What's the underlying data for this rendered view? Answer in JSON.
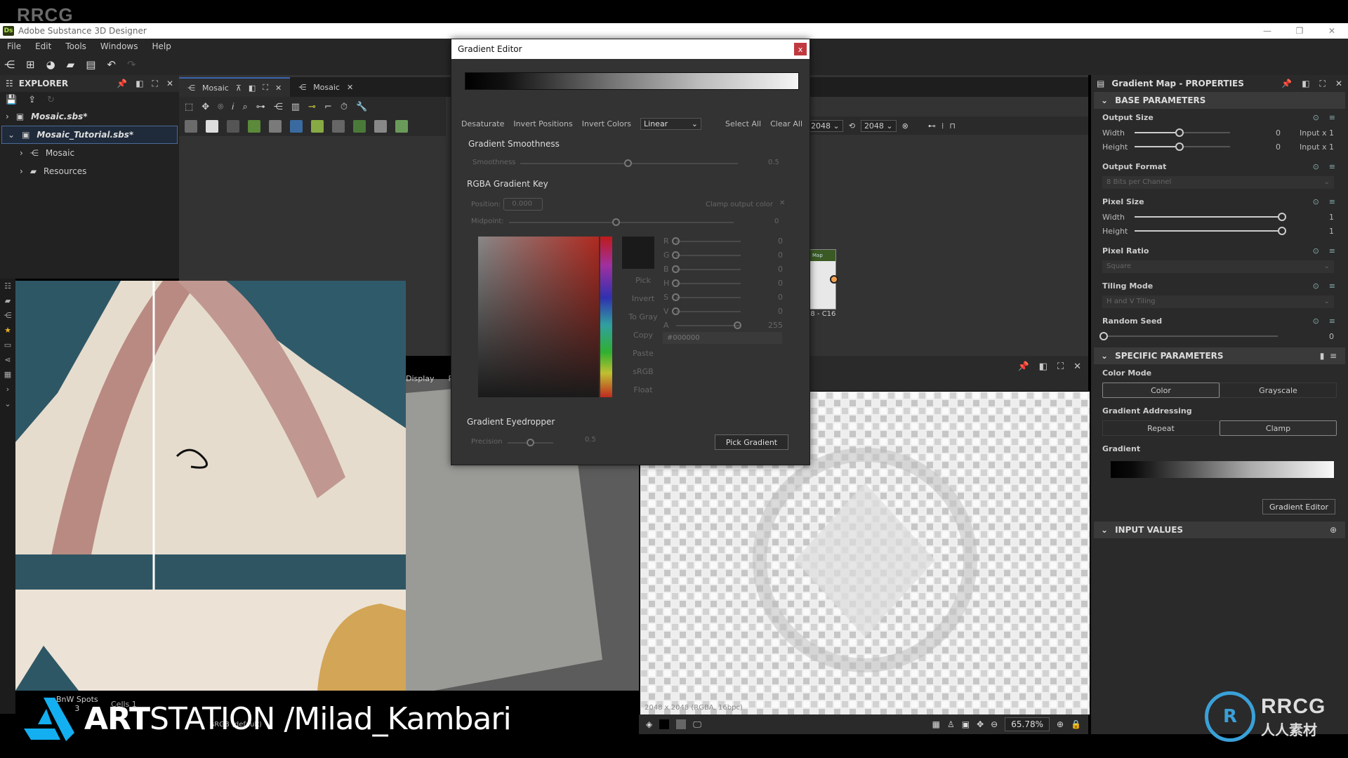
{
  "watermark_top": "RRCG",
  "app": {
    "logo": "Ds",
    "title": "Adobe Substance 3D Designer",
    "window_controls": [
      "minimize-icon",
      "restore-icon",
      "close-icon"
    ]
  },
  "menu": [
    "File",
    "Edit",
    "Tools",
    "Windows",
    "Help"
  ],
  "main_toolbar": [
    "new-graph-icon",
    "new-function-icon",
    "new-package-icon",
    "open-icon",
    "save-all-icon",
    "undo-icon",
    "redo-icon"
  ],
  "explorer": {
    "title": "EXPLORER",
    "tree": [
      {
        "label": "Mosaic.sbs*",
        "expanded": false,
        "selected": false
      },
      {
        "label": "Mosaic_Tutorial.sbs*",
        "expanded": true,
        "selected": true
      },
      {
        "label": "Mosaic",
        "type": "graph"
      },
      {
        "label": "Resources",
        "type": "folder"
      }
    ]
  },
  "graph_tabs": [
    {
      "label": "Mosaic",
      "active": true
    },
    {
      "label": "Mosaic",
      "active": false
    }
  ],
  "graph_toolbar": {
    "width_res": "2048",
    "height_res": "2048"
  },
  "node": {
    "header": "Map",
    "label": "48 - C16"
  },
  "view3d": {
    "tabs": [
      "Display",
      "R"
    ]
  },
  "view2d": {
    "info": "2048 x 2048 (RGBA, 16bpc)",
    "zoom": "65.78%"
  },
  "library_items": [
    {
      "label": "BnW Spots",
      "sub": "3"
    },
    {
      "label": "Cells 1",
      "sub": ""
    }
  ],
  "colorspace": "sRGB (default)",
  "gradient_editor": {
    "title": "Gradient Editor",
    "close": "x",
    "actions": [
      "Desaturate",
      "Invert Positions",
      "Invert Colors"
    ],
    "interpolation": "Linear",
    "select_all": "Select All",
    "clear_all": "Clear All",
    "smoothness_section": "Gradient Smoothness",
    "smoothness_label": "Smoothness",
    "smoothness_value": "0.5",
    "key_section": "RGBA Gradient Key",
    "position_label": "Position:",
    "position_value": "0.000",
    "clamp_label": "Clamp output color",
    "midpoint_label": "Midpoint:",
    "midpoint_value": "0",
    "side_buttons": [
      "Pick",
      "Invert",
      "To Gray",
      "Copy",
      "Paste",
      "sRGB",
      "Float"
    ],
    "channels": [
      {
        "name": "R",
        "value": "0",
        "fraction": 0
      },
      {
        "name": "G",
        "value": "0",
        "fraction": 0
      },
      {
        "name": "B",
        "value": "0",
        "fraction": 0
      },
      {
        "name": "H",
        "value": "0",
        "fraction": 0
      },
      {
        "name": "S",
        "value": "0",
        "fraction": 0
      },
      {
        "name": "V",
        "value": "0",
        "fraction": 0
      },
      {
        "name": "A",
        "value": "255",
        "fraction": 1
      }
    ],
    "hex": "#000000",
    "current_color": "#1a1a1a",
    "eyedropper_section": "Gradient Eyedropper",
    "precision_label": "Precision",
    "precision_value": "0.5",
    "pick_gradient": "Pick Gradient"
  },
  "properties": {
    "title": "Gradient Map - PROPERTIES",
    "base_section": "BASE PARAMETERS",
    "output_size": {
      "title": "Output Size",
      "width_label": "Width",
      "width_value": "0",
      "width_suffix": "Input x 1",
      "height_label": "Height",
      "height_value": "0",
      "height_suffix": "Input x 1"
    },
    "output_format": {
      "title": "Output Format",
      "value": "8 Bits per Channel"
    },
    "pixel_size": {
      "title": "Pixel Size",
      "width_label": "Width",
      "width_value": "1",
      "height_label": "Height",
      "height_value": "1"
    },
    "pixel_ratio": {
      "title": "Pixel Ratio",
      "value": "Square"
    },
    "tiling_mode": {
      "title": "Tiling Mode",
      "value": "H and V Tiling"
    },
    "random_seed": {
      "title": "Random Seed",
      "value": "0"
    },
    "specific_section": "SPECIFIC PARAMETERS",
    "color_mode": {
      "title": "Color Mode",
      "options": [
        "Color",
        "Grayscale"
      ],
      "selected": "Color"
    },
    "gradient_addressing": {
      "title": "Gradient Addressing",
      "options": [
        "Repeat",
        "Clamp"
      ],
      "selected": "Clamp"
    },
    "gradient_title": "Gradient",
    "gradient_editor_button": "Gradient Editor",
    "input_values_section": "INPUT VALUES"
  },
  "overlay": {
    "artstation_bold": "ART",
    "artstation_rest": "STATION /Milad_Kambari",
    "rrcg_logo": "RRCG",
    "rrcg_sub": "人人素材"
  }
}
